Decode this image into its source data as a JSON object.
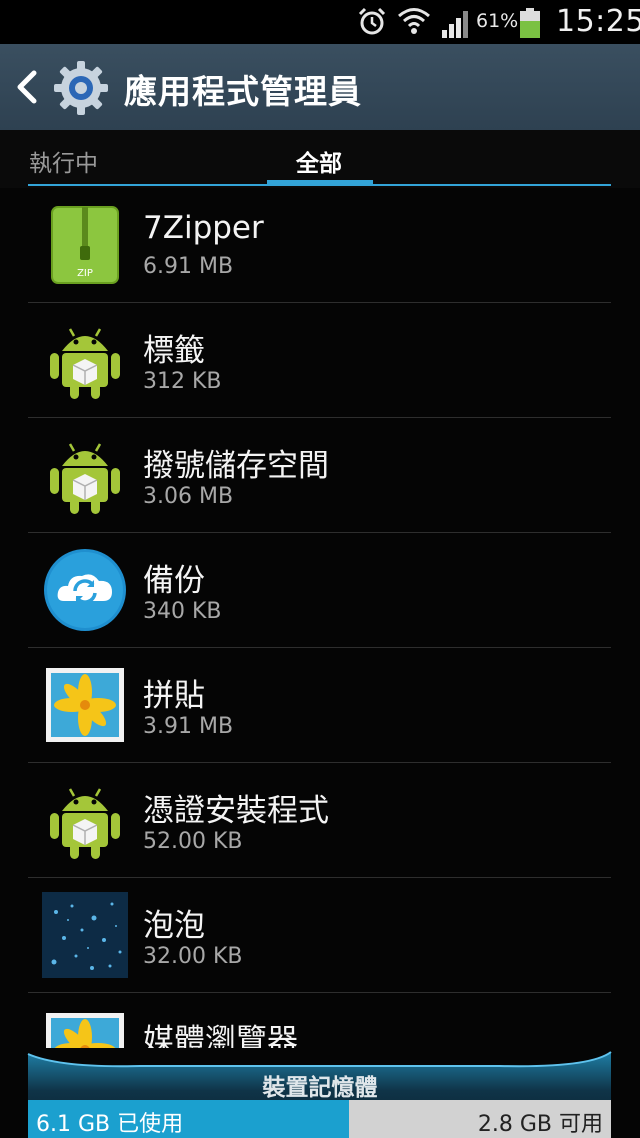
{
  "status_bar": {
    "battery_percent": "61%",
    "time": "15:25",
    "icons": [
      "alarm-icon",
      "wifi-icon",
      "signal-icon",
      "battery-icon"
    ]
  },
  "action_bar": {
    "title": "應用程式管理員",
    "icons": [
      "back-arrow-icon",
      "settings-gear-icon"
    ]
  },
  "tabs": [
    {
      "label": "執行中",
      "selected": false
    },
    {
      "label": "全部",
      "selected": true
    }
  ],
  "apps": [
    {
      "name": "7Zipper",
      "size": "6.91 MB",
      "icon": "zip-icon"
    },
    {
      "name": "標籤",
      "size": "312 KB",
      "icon": "android-icon"
    },
    {
      "name": "撥號儲存空間",
      "size": "3.06 MB",
      "icon": "android-icon"
    },
    {
      "name": "備份",
      "size": "340 KB",
      "icon": "backup-cloud-icon"
    },
    {
      "name": "拼貼",
      "size": "3.91 MB",
      "icon": "flower-photo-icon"
    },
    {
      "name": "憑證安裝程式",
      "size": "52.00 KB",
      "icon": "android-icon"
    },
    {
      "name": "泡泡",
      "size": "32.00 KB",
      "icon": "bubbles-wallpaper-icon"
    },
    {
      "name": "媒體瀏覽器",
      "size": "",
      "icon": "flower-photo-icon"
    }
  ],
  "storage": {
    "title": "裝置記憶體",
    "used_label": "6.1 GB 已使用",
    "free_label": "2.8 GB 可用",
    "used_fraction": 0.55
  },
  "colors": {
    "accent": "#33a4d8",
    "action_bar": "#344858",
    "storage_used": "#1ba0cf"
  }
}
